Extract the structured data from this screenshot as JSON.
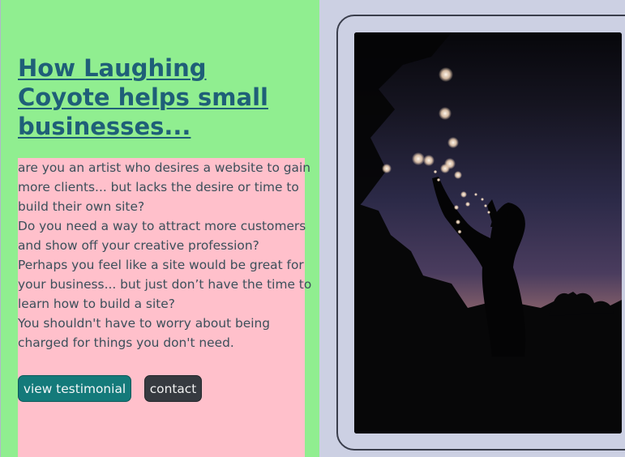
{
  "hero": {
    "heading": "How Laughing Coyote helps small businesses...",
    "paragraphs": [
      "are you an artist who desires a website to gain",
      "more clients... but lacks the desire or time to",
      "build their own site?",
      "Do you need a way to attract more customers",
      "and show off your creative profession?",
      "Perhaps you feel like a site would be great for",
      "your business... but just don’t have the time to",
      "learn how to build a site?",
      "You shouldn't have to worry about being",
      "charged for things you don't need."
    ],
    "buttons": {
      "testimonial_label": "view testimonial",
      "contact_label": "contact"
    }
  },
  "colors": {
    "left_panel_bg": "#90ee90",
    "content_box_bg": "#ffc0cb",
    "page_bg": "#ccd0e3",
    "heading_link": "#1f5f78",
    "testimonial_button_bg": "#147a7a",
    "contact_button_bg": "#363a40"
  },
  "image": {
    "subject": "silhouette of person holding string lights at dusk"
  }
}
